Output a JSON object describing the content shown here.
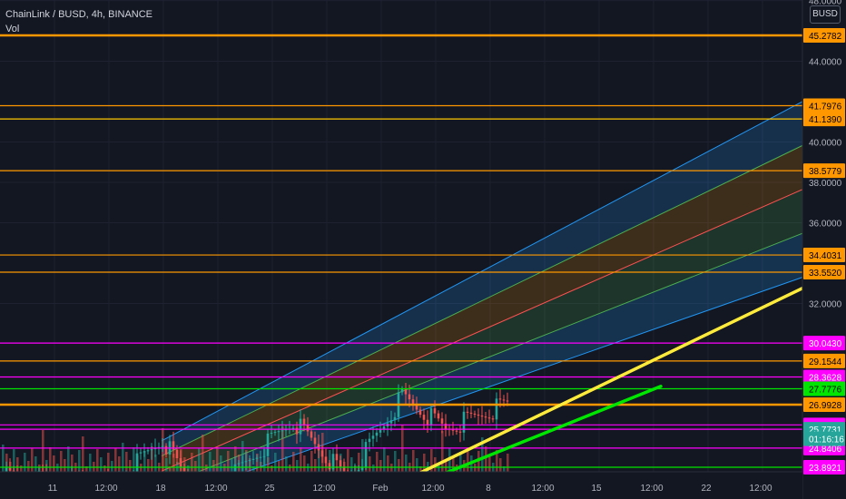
{
  "header": {
    "title": "ChainLink / BUSD, 4h, BINANCE",
    "volume": "Vol",
    "currency": "BUSD"
  },
  "chart_data": {
    "type": "candlestick",
    "title": "ChainLink / BUSD, 4h, BINANCE",
    "currency": "BUSD",
    "y_range": [
      21.4,
      47.7
    ],
    "y_ticks": [
      {
        "value": 44,
        "label": "44.0000"
      },
      {
        "value": 40,
        "label": "40.0000"
      },
      {
        "value": 38,
        "label": "38.0000"
      },
      {
        "value": 36,
        "label": "36.0000"
      },
      {
        "value": 32,
        "label": "32.0000"
      },
      {
        "value": 47,
        "label": "48.0000"
      }
    ],
    "x_ticks": [
      "11",
      "12:00",
      "18",
      "12:00",
      "25",
      "12:00",
      "Feb",
      "12:00",
      "8",
      "12:00",
      "15",
      "12:00",
      "22",
      "12:00"
    ],
    "price_levels": [
      {
        "value": 45.2782,
        "label": "45.2782",
        "color": "#ff9800",
        "badge": "#ff9800"
      },
      {
        "value": 41.7976,
        "label": "41.7976",
        "color": "#ff9800",
        "badge": "#ff9800"
      },
      {
        "value": 41.139,
        "label": "41.1390",
        "color": "#ffc700",
        "badge": "#ff9800"
      },
      {
        "value": 38.5779,
        "label": "38.5779",
        "color": "#ff9800",
        "badge": "#ff9800"
      },
      {
        "value": 34.4031,
        "label": "34.4031",
        "color": "#ff9800",
        "badge": "#ff9800"
      },
      {
        "value": 33.552,
        "label": "33.5520",
        "color": "#ff9800",
        "badge": "#ff9800"
      },
      {
        "value": 30.043,
        "label": "30.0430",
        "color": "#ff00ff",
        "badge": "#ff00ff"
      },
      {
        "value": 29.1544,
        "label": "29.1544",
        "color": "#ff9800",
        "badge": "#ff9800"
      },
      {
        "value": 28.3628,
        "label": "28.3628",
        "color": "#ff00ff",
        "badge": "#ff00ff"
      },
      {
        "value": 27.7776,
        "label": "27.7776",
        "color": "#00e600",
        "badge": "#00e600"
      },
      {
        "value": 26.9928,
        "label": "26.9928",
        "color": "#ff9800",
        "badge": "#ff9800"
      },
      {
        "value": 25.9888,
        "label": "25.9888",
        "color": "#ff00ff",
        "badge": "#ff00ff"
      },
      {
        "value": 25.7731,
        "label": "25.7731",
        "color": "#ff00ff",
        "badge": "#26a69a"
      },
      {
        "value": 24.8406,
        "label": "24.8406",
        "color": "#ff00ff",
        "badge": "#ff00ff"
      },
      {
        "value": 23.8921,
        "label": "23.8921",
        "color": "#00e600",
        "badge": "#ff00ff"
      }
    ],
    "countdown": {
      "label": "01:16:16",
      "value": 25.3
    },
    "channel": {
      "x0": 178,
      "x1": 884,
      "lower0": 22.2,
      "lower1": 33.3,
      "upper0": 25.2,
      "upper1": 42.0,
      "line_colors": [
        "#2196f3",
        "#4caf50",
        "#ff5252",
        "#4caf50",
        "#2196f3"
      ]
    },
    "trendlines": [
      {
        "x0": 370,
        "v0": 21.6,
        "x1": 932,
        "v1": 33.8,
        "color": "#ffeb3b"
      },
      {
        "x0": 380,
        "v0": 21.6,
        "x1": 728,
        "v1": 27.9,
        "color": "#00e600"
      }
    ]
  }
}
